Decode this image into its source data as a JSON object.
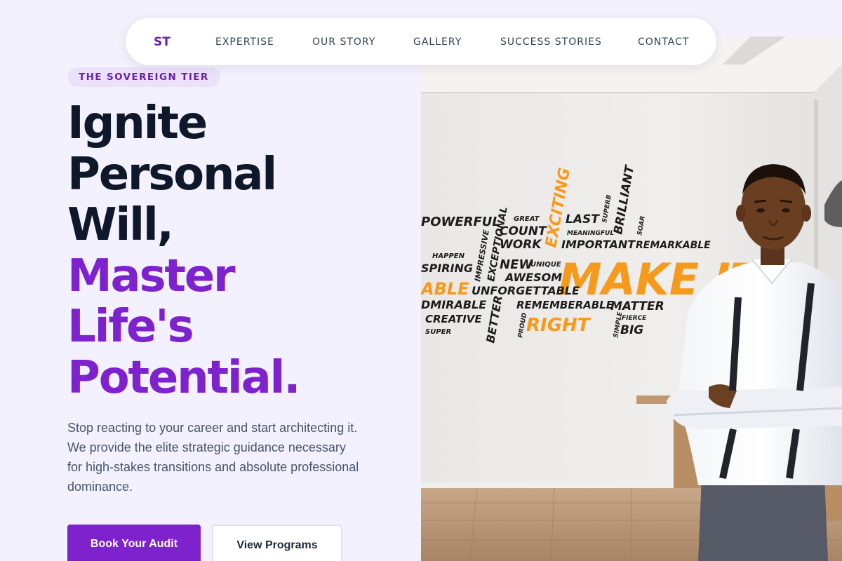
{
  "nav": {
    "logo": "ST",
    "links": [
      "EXPERTISE",
      "OUR STORY",
      "GALLERY",
      "SUCCESS STORIES",
      "CONTACT"
    ]
  },
  "hero": {
    "badge": "THE SOVEREIGN TIER",
    "headline_dark": [
      "Ignite",
      "Personal",
      "Will,"
    ],
    "headline_purple": [
      "Master",
      "Life's",
      "Potential."
    ],
    "subtext": "Stop reacting to your career and start architecting it. We provide the elite strategic guidance necessary for high-stakes transitions and absolute professional dominance.",
    "primary_button": "Book Your Audit",
    "secondary_button": "View Programs"
  },
  "image": {
    "words": [
      "POWERFUL",
      "GREAT",
      "COUNT",
      "WORK",
      "EXCITING",
      "LAST",
      "SUPERB",
      "BRILLIANT",
      "MEANINGFUL",
      "IMPORTANT",
      "SOAR",
      "REMARKABLE",
      "HAPPEN",
      "SPIRING",
      "IMPRESSIVE",
      "EXCEPTIONAL",
      "NEW",
      "UNIQUE",
      "AWESOME",
      "MAKE IT",
      "ABLE",
      "UNFORGETTABLE",
      "DMIRABLE",
      "BETTER",
      "REMEMBERABLE",
      "MATTER",
      "CREATIVE",
      "PROUD",
      "RIGHT",
      "SIMPLE",
      "FIERCE",
      "BIG",
      "SUPER"
    ]
  },
  "colors": {
    "accent": "#7e22ce",
    "dark": "#0f172a",
    "background": "#f3f1fd",
    "highlight_word": "#f59a1b"
  }
}
